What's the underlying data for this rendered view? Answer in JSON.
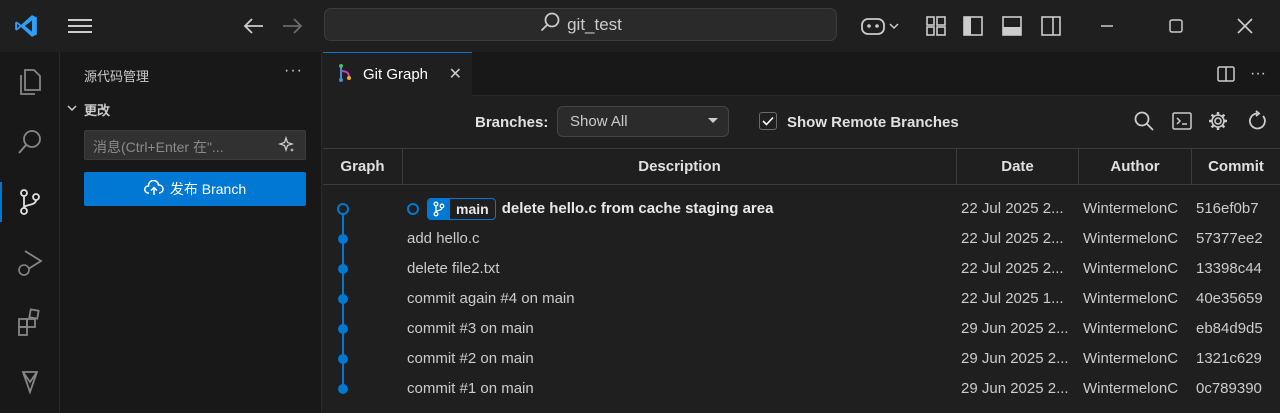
{
  "titlebar": {
    "search_text": "git_test",
    "icons": [
      "vscode-logo-icon",
      "menu-icon",
      "back-arrow-icon",
      "forward-arrow-icon",
      "search-icon",
      "copilot-icon",
      "layout-icon",
      "toggle-primary-sidebar-icon",
      "toggle-panel-icon",
      "toggle-secondary-sidebar-icon",
      "minimize-icon",
      "maximize-icon",
      "close-icon"
    ]
  },
  "activitybar": {
    "items": [
      "explorer-icon",
      "search-icon",
      "source-control-icon",
      "run-debug-icon",
      "extensions-icon",
      "git-graph-activity-icon"
    ],
    "active": "source-control-icon"
  },
  "sidebar": {
    "title": "源代码管理",
    "more": "···",
    "changes_label": "更改",
    "message_placeholder": "消息(Ctrl+Enter 在\"...",
    "publish_button": "发布 Branch"
  },
  "tab": {
    "label": "Git Graph",
    "close": "✕"
  },
  "controls": {
    "branches_label": "Branches:",
    "branch_select_value": "Show All",
    "show_remote_label": "Show Remote Branches",
    "show_remote_checked": true
  },
  "table": {
    "columns": [
      "Graph",
      "Description",
      "Date",
      "Author",
      "Commit"
    ],
    "head_branch": "main",
    "rows": [
      {
        "description": "delete hello.c from cache staging area",
        "date": "22 Jul 2025 2...",
        "author": "WintermelonC",
        "commit": "516ef0b7",
        "is_head": true
      },
      {
        "description": "add hello.c",
        "date": "22 Jul 2025 2...",
        "author": "WintermelonC",
        "commit": "57377ee2",
        "is_head": false
      },
      {
        "description": "delete file2.txt",
        "date": "22 Jul 2025 2...",
        "author": "WintermelonC",
        "commit": "13398c44",
        "is_head": false
      },
      {
        "description": "commit again #4 on main",
        "date": "22 Jul 2025 1...",
        "author": "WintermelonC",
        "commit": "40e35659",
        "is_head": false
      },
      {
        "description": "commit #3 on main",
        "date": "29 Jun 2025 2...",
        "author": "WintermelonC",
        "commit": "eb84d9d5",
        "is_head": false
      },
      {
        "description": "commit #2 on main",
        "date": "29 Jun 2025 2...",
        "author": "WintermelonC",
        "commit": "1321c629",
        "is_head": false
      },
      {
        "description": "commit #1 on main",
        "date": "29 Jun 2025 2...",
        "author": "WintermelonC",
        "commit": "0c789390",
        "is_head": false
      }
    ]
  },
  "colors": {
    "accent": "#0078d4",
    "graph_line": "#0078d4",
    "background": "#1f1f1f"
  }
}
